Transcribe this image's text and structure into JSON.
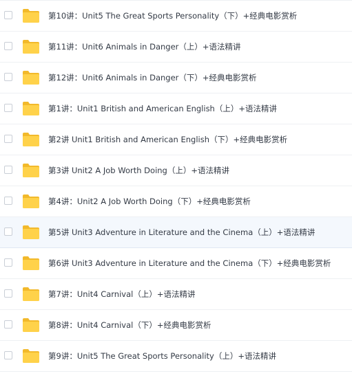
{
  "files": [
    {
      "name": "第10讲：Unit5 The Great Sports Personality（下）+经典电影赏析",
      "icon": "folder-icon"
    },
    {
      "name": "第11讲：Unit6 Animals in Danger（上）+语法精讲",
      "icon": "folder-icon"
    },
    {
      "name": "第12讲：Unit6 Animals in Danger（下）+经典电影赏析",
      "icon": "folder-icon"
    },
    {
      "name": "第1讲：Unit1 British and American English（上）+语法精讲",
      "icon": "folder-icon"
    },
    {
      "name": "第2讲 Unit1 British and American English（下）+经典电影赏析",
      "icon": "folder-icon"
    },
    {
      "name": "第3讲 Unit2 A Job Worth Doing（上）+语法精讲",
      "icon": "folder-icon"
    },
    {
      "name": "第4讲：Unit2 A Job Worth Doing（下）+经典电影赏析",
      "icon": "folder-icon"
    },
    {
      "name": "第5讲 Unit3 Adventure in Literature and the Cinema（上）+语法精讲",
      "icon": "folder-icon",
      "highlighted": true
    },
    {
      "name": "第6讲 Unit3 Adventure in Literature and the Cinema（下）+经典电影赏析",
      "icon": "folder-icon"
    },
    {
      "name": "第7讲：Unit4 Carnival（上）+语法精讲",
      "icon": "folder-icon"
    },
    {
      "name": "第8讲：Unit4 Carnival（下）+经典电影赏析",
      "icon": "folder-icon"
    },
    {
      "name": "第9讲：Unit5 The Great Sports Personality（上）+语法精讲",
      "icon": "folder-icon"
    }
  ],
  "colors": {
    "folder_front": "#ffd24a",
    "folder_back": "#f2b92b",
    "highlight_row": "#f4f8fd",
    "text": "#333a45"
  }
}
